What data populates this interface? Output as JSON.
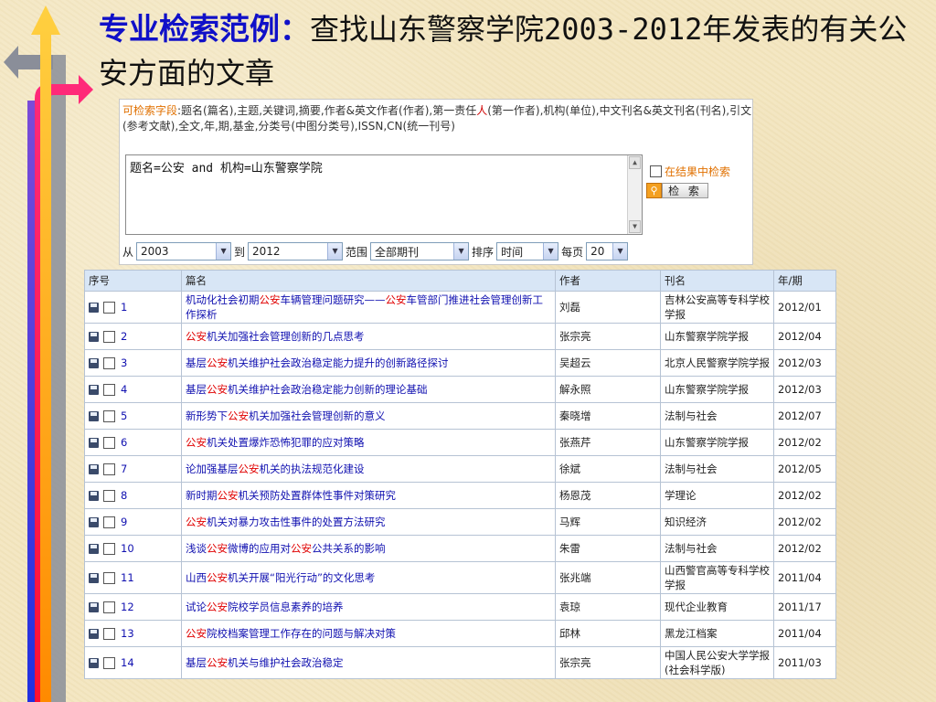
{
  "title": {
    "highlight": "专业检索范例：",
    "rest": "查找山东警察学院2003-2012年发表的有关公安方面的文章"
  },
  "search": {
    "fields_label": "可检索字段",
    "fields_a": ":题名(篇名),主题,关键词,摘要,作者&英文作者(作者),第一责任",
    "fields_red": "人",
    "fields_b": "(第一作者),机构(单位),中文刊名&英文刊名(刊名),引文(参考文献),全文,年,期,基金,分类号(中图分类号),ISSN,CN(统一刊号)",
    "query": "题名=公安 and 机构=山东警察学院",
    "in_results_label": "在结果中检索",
    "search_button": "检 索",
    "from_label": "从",
    "from_value": "2003",
    "to_label": "到",
    "to_value": "2012",
    "range_label": "范围",
    "range_value": "全部期刊",
    "sort_label": "排序",
    "sort_value": "时间",
    "per_page_label": "每页",
    "per_page_value": "20"
  },
  "table": {
    "headers": [
      "序号",
      "篇名",
      "作者",
      "刊名",
      "年/期"
    ],
    "rows": [
      {
        "n": "1",
        "pre": "机动化社会初期",
        "hl": "公安",
        "mid": "车辆管理问题研究——",
        "hl2": "公安",
        "post": "车管部门推进社会管理创新工作探析",
        "author": "刘磊",
        "journal": "吉林公安高等专科学校学报",
        "issue": "2012/01"
      },
      {
        "n": "2",
        "pre": "",
        "hl": "公安",
        "mid": "机关加强社会管理创新的几点思考",
        "hl2": "",
        "post": "",
        "author": "张宗亮",
        "journal": "山东警察学院学报",
        "issue": "2012/04"
      },
      {
        "n": "3",
        "pre": "基层",
        "hl": "公安",
        "mid": "机关维护社会政治稳定能力提升的创新路径探讨",
        "hl2": "",
        "post": "",
        "author": "吴超云",
        "journal": "北京人民警察学院学报",
        "issue": "2012/03"
      },
      {
        "n": "4",
        "pre": "基层",
        "hl": "公安",
        "mid": "机关维护社会政治稳定能力创新的理论基础",
        "hl2": "",
        "post": "",
        "author": "解永照",
        "journal": "山东警察学院学报",
        "issue": "2012/03"
      },
      {
        "n": "5",
        "pre": "新形势下",
        "hl": "公安",
        "mid": "机关加强社会管理创新的意义",
        "hl2": "",
        "post": "",
        "author": "秦晓增",
        "journal": "法制与社会",
        "issue": "2012/07"
      },
      {
        "n": "6",
        "pre": "",
        "hl": "公安",
        "mid": "机关处置爆炸恐怖犯罪的应对策略",
        "hl2": "",
        "post": "",
        "author": "张燕芹",
        "journal": "山东警察学院学报",
        "issue": "2012/02"
      },
      {
        "n": "7",
        "pre": "论加强基层",
        "hl": "公安",
        "mid": "机关的执法规范化建设",
        "hl2": "",
        "post": "",
        "author": "徐斌",
        "journal": "法制与社会",
        "issue": "2012/05"
      },
      {
        "n": "8",
        "pre": "新时期",
        "hl": "公安",
        "mid": "机关预防处置群体性事件对策研究",
        "hl2": "",
        "post": "",
        "author": "杨恩茂",
        "journal": "学理论",
        "issue": "2012/02"
      },
      {
        "n": "9",
        "pre": "",
        "hl": "公安",
        "mid": "机关对暴力攻击性事件的处置方法研究",
        "hl2": "",
        "post": "",
        "author": "马辉",
        "journal": "知识经济",
        "issue": "2012/02"
      },
      {
        "n": "10",
        "pre": "浅谈",
        "hl": "公安",
        "mid": "微博的应用对",
        "hl2": "公安",
        "post": "公共关系的影响",
        "author": "朱雷",
        "journal": "法制与社会",
        "issue": "2012/02"
      },
      {
        "n": "11",
        "pre": "山西",
        "hl": "公安",
        "mid": "机关开展“阳光行动”的文化思考",
        "hl2": "",
        "post": "",
        "author": "张兆端",
        "journal": "山西警官高等专科学校学报",
        "issue": "2011/04"
      },
      {
        "n": "12",
        "pre": "试论",
        "hl": "公安",
        "mid": "院校学员信息素养的培养",
        "hl2": "",
        "post": "",
        "author": "袁琼",
        "journal": "现代企业教育",
        "issue": "2011/17"
      },
      {
        "n": "13",
        "pre": "",
        "hl": "公安",
        "mid": "院校档案管理工作存在的问题与解决对策",
        "hl2": "",
        "post": "",
        "author": "邱林",
        "journal": "黑龙江档案",
        "issue": "2011/04"
      },
      {
        "n": "14",
        "pre": "基层",
        "hl": "公安",
        "mid": "机关与维护社会政治稳定",
        "hl2": "",
        "post": "",
        "author": "张宗亮",
        "journal": "中国人民公安大学学报(社会科学版)",
        "issue": "2011/03"
      }
    ]
  },
  "colors": {
    "title_highlight": "#1010c8",
    "keyword": "#e00000",
    "link": "#1010b0",
    "header_bg": "#d8e6f6"
  }
}
